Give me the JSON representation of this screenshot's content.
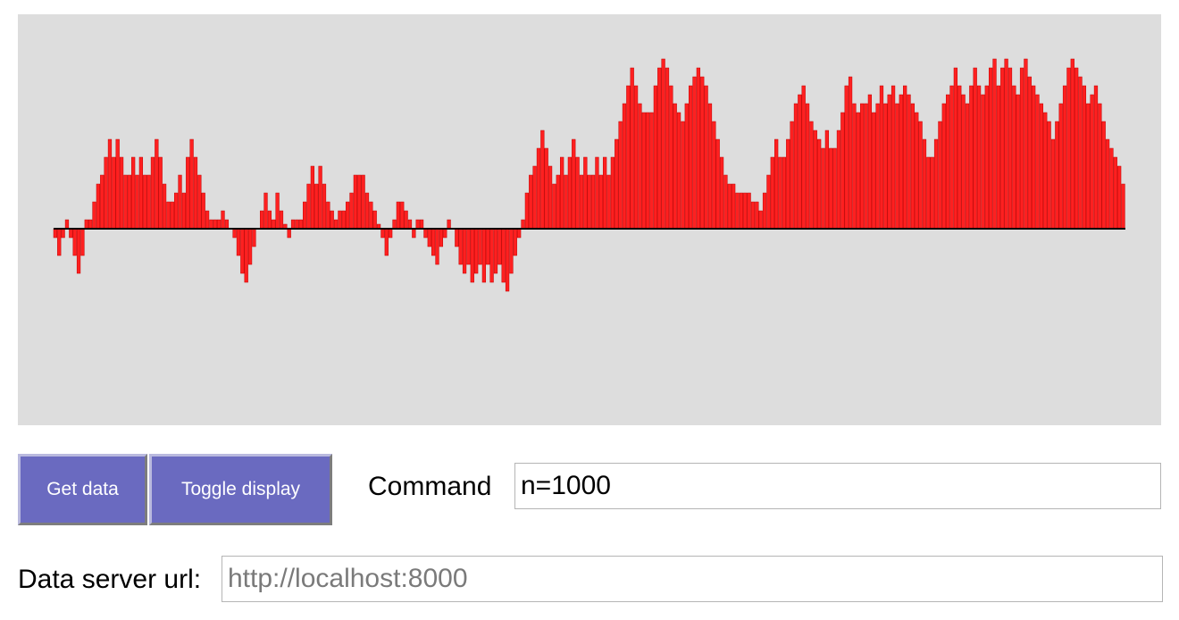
{
  "chart_data": {
    "type": "bar",
    "x": [
      0,
      1,
      2,
      3,
      4,
      5,
      6,
      7,
      8,
      9,
      10,
      11,
      12,
      13,
      14,
      15,
      16,
      17,
      18,
      19,
      20,
      21,
      22,
      23,
      24,
      25,
      26,
      27,
      28,
      29,
      30,
      31,
      32,
      33,
      34,
      35,
      36,
      37,
      38,
      39,
      40,
      41,
      42,
      43,
      44,
      45,
      46,
      47,
      48,
      49,
      50,
      51,
      52,
      53,
      54,
      55,
      56,
      57,
      58,
      59,
      60,
      61,
      62,
      63,
      64,
      65,
      66,
      67,
      68,
      69,
      70,
      71,
      72,
      73,
      74,
      75,
      76,
      77,
      78,
      79,
      80,
      81,
      82,
      83,
      84,
      85,
      86,
      87,
      88,
      89,
      90,
      91,
      92,
      93,
      94,
      95,
      96,
      97,
      98,
      99,
      100,
      101,
      102,
      103,
      104,
      105,
      106,
      107,
      108,
      109,
      110,
      111,
      112,
      113,
      114,
      115,
      116,
      117,
      118,
      119,
      120,
      121,
      122,
      123,
      124,
      125,
      126,
      127,
      128,
      129,
      130,
      131,
      132,
      133,
      134,
      135,
      136,
      137,
      138,
      139,
      140,
      141,
      142,
      143,
      144,
      145,
      146,
      147,
      148,
      149,
      150,
      151,
      152,
      153,
      154,
      155,
      156,
      157,
      158,
      159,
      160,
      161,
      162,
      163,
      164,
      165,
      166,
      167,
      168,
      169,
      170,
      171,
      172,
      173,
      174,
      175,
      176,
      177,
      178,
      179,
      180,
      181,
      182,
      183,
      184,
      185,
      186,
      187,
      188,
      189,
      190,
      191,
      192,
      193,
      194,
      195,
      196,
      197,
      198,
      199,
      200,
      201,
      202,
      203,
      204,
      205,
      206,
      207,
      208,
      209,
      210,
      211,
      212,
      213,
      214,
      215,
      216,
      217,
      218,
      219,
      220,
      221,
      222,
      223,
      224,
      225,
      226,
      227,
      228,
      229,
      230,
      231,
      232,
      233,
      234,
      235,
      236,
      237,
      238,
      239,
      240,
      241,
      242,
      243,
      244,
      245,
      246,
      247,
      248,
      249,
      250,
      251,
      252,
      253,
      254,
      255,
      256,
      257,
      258,
      259,
      260,
      261,
      262,
      263,
      264,
      265,
      266,
      267,
      268,
      269,
      270,
      271,
      272,
      273,
      274,
      275,
      276,
      277,
      278,
      279,
      280,
      281,
      282,
      283,
      284,
      285,
      286,
      287,
      288,
      289,
      290,
      291,
      292,
      293,
      294,
      295,
      296,
      297,
      298,
      299,
      300
    ],
    "values": [
      -1.0,
      -3.0,
      -1.0,
      1.0,
      -1.0,
      -3.0,
      -5.0,
      -3.0,
      1.0,
      1.0,
      3.0,
      5.0,
      6.0,
      8.0,
      10.0,
      8.0,
      10.0,
      8.0,
      6.0,
      6.0,
      8.0,
      6.0,
      8.0,
      6.0,
      6.0,
      8.0,
      10.0,
      8.0,
      5.0,
      3.0,
      3.0,
      4.0,
      6.0,
      4.0,
      8.0,
      10.0,
      8.0,
      6.0,
      4.0,
      2.0,
      1.0,
      1.0,
      1.0,
      2.0,
      1.0,
      0.0,
      -1.0,
      -3.0,
      -5.0,
      -6.0,
      -4.0,
      -2.0,
      0.0,
      2.0,
      4.0,
      2.0,
      1.0,
      4.0,
      2.0,
      0.5,
      -1.0,
      1.0,
      1.0,
      1.0,
      3.0,
      5.0,
      7.0,
      5.0,
      7.0,
      5.0,
      3.0,
      2.0,
      1.0,
      2.0,
      2.0,
      3.0,
      4.0,
      6.0,
      6.0,
      6.0,
      4.0,
      3.0,
      2.0,
      0.5,
      -1.0,
      -3.0,
      -1.0,
      1.0,
      3.0,
      3.0,
      2.0,
      1.0,
      -1.0,
      1.0,
      1.0,
      -1.0,
      -2.0,
      -3.0,
      -4.0,
      -2.0,
      -1.0,
      1.0,
      0.0,
      -2.0,
      -4.0,
      -5.0,
      -4.0,
      -6.0,
      -5.0,
      -4.0,
      -6.0,
      -4.0,
      -6.0,
      -5.0,
      -4.0,
      -6.0,
      -7.0,
      -5.0,
      -3.0,
      -1.0,
      1.0,
      4.0,
      6.0,
      7.0,
      9.0,
      11.0,
      9.0,
      7.0,
      5.0,
      6.0,
      8.0,
      6.0,
      8.0,
      10.0,
      8.0,
      6.0,
      8.0,
      6.0,
      6.0,
      8.0,
      6.0,
      8.0,
      6.0,
      8.0,
      10.0,
      12.0,
      14.0,
      16.0,
      18.0,
      16.0,
      14.0,
      13.0,
      13.0,
      13.0,
      16.0,
      18.0,
      19.0,
      18.0,
      16.0,
      14.0,
      13.0,
      12.0,
      14.0,
      16.0,
      17.0,
      18.0,
      17.0,
      16.0,
      14.0,
      12.0,
      10.0,
      8.0,
      6.0,
      5.0,
      5.0,
      4.0,
      4.0,
      4.0,
      4.0,
      3.0,
      3.0,
      2.0,
      4.0,
      6.0,
      8.0,
      10.0,
      8.0,
      8.0,
      10.0,
      12.0,
      14.0,
      15.0,
      16.0,
      14.0,
      12.0,
      11.0,
      10.0,
      9.0,
      11.0,
      9.0,
      9.0,
      11.0,
      13.0,
      16.0,
      17.0,
      14.0,
      13.0,
      14.0,
      14.0,
      15.0,
      13.0,
      14.0,
      16.0,
      14.0,
      15.0,
      16.0,
      14.0,
      15.0,
      16.0,
      15.0,
      14.0,
      13.0,
      12.0,
      10.0,
      8.0,
      8.0,
      10.0,
      12.0,
      14.0,
      15.0,
      16.0,
      18.0,
      16.0,
      15.0,
      14.0,
      16.0,
      18.0,
      16.0,
      15.0,
      16.0,
      18.0,
      19.0,
      16.0,
      18.0,
      19.0,
      18.0,
      16.0,
      15.0,
      18.0,
      19.0,
      17.0,
      16.0,
      15.0,
      14.0,
      13.0,
      12.0,
      10.0,
      12.0,
      14.0,
      16.0,
      18.0,
      19.0,
      18.0,
      17.0,
      16.0,
      14.0,
      15.0,
      16.0,
      14.0,
      12.0,
      10.0,
      9.0,
      8.0,
      7.0,
      5.0
    ],
    "ylim": [
      -20,
      22
    ],
    "grid": false,
    "baseline": 0,
    "colors": {
      "bar": "#ff2020",
      "bar_edge": "#c00000",
      "baseline": "#000000",
      "background": "#dddddd"
    }
  },
  "controls": {
    "get_data_label": "Get data",
    "toggle_display_label": "Toggle display",
    "command_label": "Command",
    "command_value": "n=1000",
    "server_url_label": "Data server url:",
    "server_url_placeholder": "http://localhost:8000"
  },
  "colors": {
    "button_bg": "#6a6ac0",
    "button_text": "#ffffff",
    "chart_bg": "#dddddd"
  }
}
